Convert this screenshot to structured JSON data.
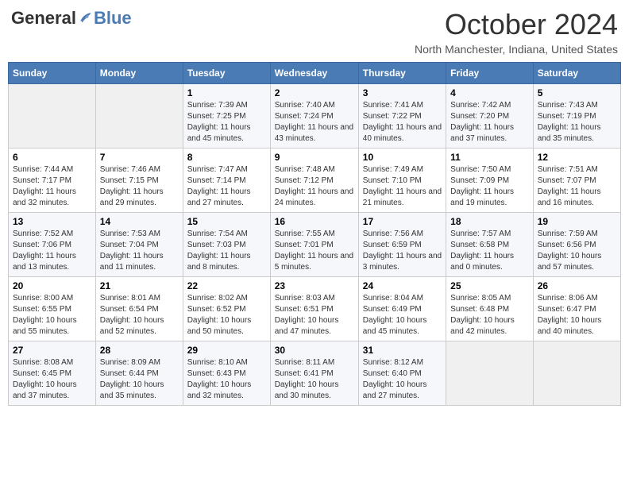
{
  "header": {
    "logo_general": "General",
    "logo_blue": "Blue",
    "title": "October 2024",
    "location": "North Manchester, Indiana, United States"
  },
  "weekdays": [
    "Sunday",
    "Monday",
    "Tuesday",
    "Wednesday",
    "Thursday",
    "Friday",
    "Saturday"
  ],
  "weeks": [
    [
      {
        "day": "",
        "sunrise": "",
        "sunset": "",
        "daylight": ""
      },
      {
        "day": "",
        "sunrise": "",
        "sunset": "",
        "daylight": ""
      },
      {
        "day": "1",
        "sunrise": "Sunrise: 7:39 AM",
        "sunset": "Sunset: 7:25 PM",
        "daylight": "Daylight: 11 hours and 45 minutes."
      },
      {
        "day": "2",
        "sunrise": "Sunrise: 7:40 AM",
        "sunset": "Sunset: 7:24 PM",
        "daylight": "Daylight: 11 hours and 43 minutes."
      },
      {
        "day": "3",
        "sunrise": "Sunrise: 7:41 AM",
        "sunset": "Sunset: 7:22 PM",
        "daylight": "Daylight: 11 hours and 40 minutes."
      },
      {
        "day": "4",
        "sunrise": "Sunrise: 7:42 AM",
        "sunset": "Sunset: 7:20 PM",
        "daylight": "Daylight: 11 hours and 37 minutes."
      },
      {
        "day": "5",
        "sunrise": "Sunrise: 7:43 AM",
        "sunset": "Sunset: 7:19 PM",
        "daylight": "Daylight: 11 hours and 35 minutes."
      }
    ],
    [
      {
        "day": "6",
        "sunrise": "Sunrise: 7:44 AM",
        "sunset": "Sunset: 7:17 PM",
        "daylight": "Daylight: 11 hours and 32 minutes."
      },
      {
        "day": "7",
        "sunrise": "Sunrise: 7:46 AM",
        "sunset": "Sunset: 7:15 PM",
        "daylight": "Daylight: 11 hours and 29 minutes."
      },
      {
        "day": "8",
        "sunrise": "Sunrise: 7:47 AM",
        "sunset": "Sunset: 7:14 PM",
        "daylight": "Daylight: 11 hours and 27 minutes."
      },
      {
        "day": "9",
        "sunrise": "Sunrise: 7:48 AM",
        "sunset": "Sunset: 7:12 PM",
        "daylight": "Daylight: 11 hours and 24 minutes."
      },
      {
        "day": "10",
        "sunrise": "Sunrise: 7:49 AM",
        "sunset": "Sunset: 7:10 PM",
        "daylight": "Daylight: 11 hours and 21 minutes."
      },
      {
        "day": "11",
        "sunrise": "Sunrise: 7:50 AM",
        "sunset": "Sunset: 7:09 PM",
        "daylight": "Daylight: 11 hours and 19 minutes."
      },
      {
        "day": "12",
        "sunrise": "Sunrise: 7:51 AM",
        "sunset": "Sunset: 7:07 PM",
        "daylight": "Daylight: 11 hours and 16 minutes."
      }
    ],
    [
      {
        "day": "13",
        "sunrise": "Sunrise: 7:52 AM",
        "sunset": "Sunset: 7:06 PM",
        "daylight": "Daylight: 11 hours and 13 minutes."
      },
      {
        "day": "14",
        "sunrise": "Sunrise: 7:53 AM",
        "sunset": "Sunset: 7:04 PM",
        "daylight": "Daylight: 11 hours and 11 minutes."
      },
      {
        "day": "15",
        "sunrise": "Sunrise: 7:54 AM",
        "sunset": "Sunset: 7:03 PM",
        "daylight": "Daylight: 11 hours and 8 minutes."
      },
      {
        "day": "16",
        "sunrise": "Sunrise: 7:55 AM",
        "sunset": "Sunset: 7:01 PM",
        "daylight": "Daylight: 11 hours and 5 minutes."
      },
      {
        "day": "17",
        "sunrise": "Sunrise: 7:56 AM",
        "sunset": "Sunset: 6:59 PM",
        "daylight": "Daylight: 11 hours and 3 minutes."
      },
      {
        "day": "18",
        "sunrise": "Sunrise: 7:57 AM",
        "sunset": "Sunset: 6:58 PM",
        "daylight": "Daylight: 11 hours and 0 minutes."
      },
      {
        "day": "19",
        "sunrise": "Sunrise: 7:59 AM",
        "sunset": "Sunset: 6:56 PM",
        "daylight": "Daylight: 10 hours and 57 minutes."
      }
    ],
    [
      {
        "day": "20",
        "sunrise": "Sunrise: 8:00 AM",
        "sunset": "Sunset: 6:55 PM",
        "daylight": "Daylight: 10 hours and 55 minutes."
      },
      {
        "day": "21",
        "sunrise": "Sunrise: 8:01 AM",
        "sunset": "Sunset: 6:54 PM",
        "daylight": "Daylight: 10 hours and 52 minutes."
      },
      {
        "day": "22",
        "sunrise": "Sunrise: 8:02 AM",
        "sunset": "Sunset: 6:52 PM",
        "daylight": "Daylight: 10 hours and 50 minutes."
      },
      {
        "day": "23",
        "sunrise": "Sunrise: 8:03 AM",
        "sunset": "Sunset: 6:51 PM",
        "daylight": "Daylight: 10 hours and 47 minutes."
      },
      {
        "day": "24",
        "sunrise": "Sunrise: 8:04 AM",
        "sunset": "Sunset: 6:49 PM",
        "daylight": "Daylight: 10 hours and 45 minutes."
      },
      {
        "day": "25",
        "sunrise": "Sunrise: 8:05 AM",
        "sunset": "Sunset: 6:48 PM",
        "daylight": "Daylight: 10 hours and 42 minutes."
      },
      {
        "day": "26",
        "sunrise": "Sunrise: 8:06 AM",
        "sunset": "Sunset: 6:47 PM",
        "daylight": "Daylight: 10 hours and 40 minutes."
      }
    ],
    [
      {
        "day": "27",
        "sunrise": "Sunrise: 8:08 AM",
        "sunset": "Sunset: 6:45 PM",
        "daylight": "Daylight: 10 hours and 37 minutes."
      },
      {
        "day": "28",
        "sunrise": "Sunrise: 8:09 AM",
        "sunset": "Sunset: 6:44 PM",
        "daylight": "Daylight: 10 hours and 35 minutes."
      },
      {
        "day": "29",
        "sunrise": "Sunrise: 8:10 AM",
        "sunset": "Sunset: 6:43 PM",
        "daylight": "Daylight: 10 hours and 32 minutes."
      },
      {
        "day": "30",
        "sunrise": "Sunrise: 8:11 AM",
        "sunset": "Sunset: 6:41 PM",
        "daylight": "Daylight: 10 hours and 30 minutes."
      },
      {
        "day": "31",
        "sunrise": "Sunrise: 8:12 AM",
        "sunset": "Sunset: 6:40 PM",
        "daylight": "Daylight: 10 hours and 27 minutes."
      },
      {
        "day": "",
        "sunrise": "",
        "sunset": "",
        "daylight": ""
      },
      {
        "day": "",
        "sunrise": "",
        "sunset": "",
        "daylight": ""
      }
    ]
  ]
}
